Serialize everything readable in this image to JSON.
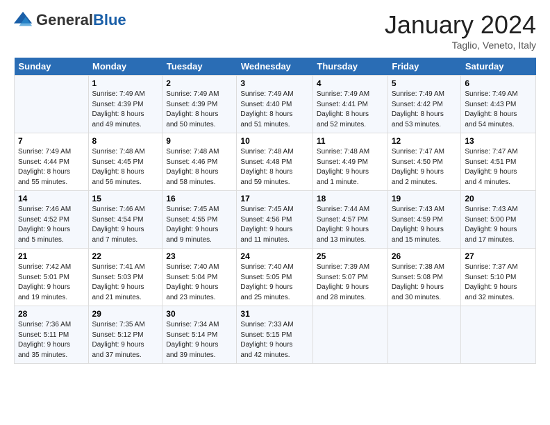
{
  "header": {
    "logo_general": "General",
    "logo_blue": "Blue",
    "month_title": "January 2024",
    "subtitle": "Taglio, Veneto, Italy"
  },
  "weekdays": [
    "Sunday",
    "Monday",
    "Tuesday",
    "Wednesday",
    "Thursday",
    "Friday",
    "Saturday"
  ],
  "weeks": [
    [
      {
        "day": "",
        "info": ""
      },
      {
        "day": "1",
        "info": "Sunrise: 7:49 AM\nSunset: 4:39 PM\nDaylight: 8 hours\nand 49 minutes."
      },
      {
        "day": "2",
        "info": "Sunrise: 7:49 AM\nSunset: 4:39 PM\nDaylight: 8 hours\nand 50 minutes."
      },
      {
        "day": "3",
        "info": "Sunrise: 7:49 AM\nSunset: 4:40 PM\nDaylight: 8 hours\nand 51 minutes."
      },
      {
        "day": "4",
        "info": "Sunrise: 7:49 AM\nSunset: 4:41 PM\nDaylight: 8 hours\nand 52 minutes."
      },
      {
        "day": "5",
        "info": "Sunrise: 7:49 AM\nSunset: 4:42 PM\nDaylight: 8 hours\nand 53 minutes."
      },
      {
        "day": "6",
        "info": "Sunrise: 7:49 AM\nSunset: 4:43 PM\nDaylight: 8 hours\nand 54 minutes."
      }
    ],
    [
      {
        "day": "7",
        "info": "Sunrise: 7:49 AM\nSunset: 4:44 PM\nDaylight: 8 hours\nand 55 minutes."
      },
      {
        "day": "8",
        "info": "Sunrise: 7:48 AM\nSunset: 4:45 PM\nDaylight: 8 hours\nand 56 minutes."
      },
      {
        "day": "9",
        "info": "Sunrise: 7:48 AM\nSunset: 4:46 PM\nDaylight: 8 hours\nand 58 minutes."
      },
      {
        "day": "10",
        "info": "Sunrise: 7:48 AM\nSunset: 4:48 PM\nDaylight: 8 hours\nand 59 minutes."
      },
      {
        "day": "11",
        "info": "Sunrise: 7:48 AM\nSunset: 4:49 PM\nDaylight: 9 hours\nand 1 minute."
      },
      {
        "day": "12",
        "info": "Sunrise: 7:47 AM\nSunset: 4:50 PM\nDaylight: 9 hours\nand 2 minutes."
      },
      {
        "day": "13",
        "info": "Sunrise: 7:47 AM\nSunset: 4:51 PM\nDaylight: 9 hours\nand 4 minutes."
      }
    ],
    [
      {
        "day": "14",
        "info": "Sunrise: 7:46 AM\nSunset: 4:52 PM\nDaylight: 9 hours\nand 5 minutes."
      },
      {
        "day": "15",
        "info": "Sunrise: 7:46 AM\nSunset: 4:54 PM\nDaylight: 9 hours\nand 7 minutes."
      },
      {
        "day": "16",
        "info": "Sunrise: 7:45 AM\nSunset: 4:55 PM\nDaylight: 9 hours\nand 9 minutes."
      },
      {
        "day": "17",
        "info": "Sunrise: 7:45 AM\nSunset: 4:56 PM\nDaylight: 9 hours\nand 11 minutes."
      },
      {
        "day": "18",
        "info": "Sunrise: 7:44 AM\nSunset: 4:57 PM\nDaylight: 9 hours\nand 13 minutes."
      },
      {
        "day": "19",
        "info": "Sunrise: 7:43 AM\nSunset: 4:59 PM\nDaylight: 9 hours\nand 15 minutes."
      },
      {
        "day": "20",
        "info": "Sunrise: 7:43 AM\nSunset: 5:00 PM\nDaylight: 9 hours\nand 17 minutes."
      }
    ],
    [
      {
        "day": "21",
        "info": "Sunrise: 7:42 AM\nSunset: 5:01 PM\nDaylight: 9 hours\nand 19 minutes."
      },
      {
        "day": "22",
        "info": "Sunrise: 7:41 AM\nSunset: 5:03 PM\nDaylight: 9 hours\nand 21 minutes."
      },
      {
        "day": "23",
        "info": "Sunrise: 7:40 AM\nSunset: 5:04 PM\nDaylight: 9 hours\nand 23 minutes."
      },
      {
        "day": "24",
        "info": "Sunrise: 7:40 AM\nSunset: 5:05 PM\nDaylight: 9 hours\nand 25 minutes."
      },
      {
        "day": "25",
        "info": "Sunrise: 7:39 AM\nSunset: 5:07 PM\nDaylight: 9 hours\nand 28 minutes."
      },
      {
        "day": "26",
        "info": "Sunrise: 7:38 AM\nSunset: 5:08 PM\nDaylight: 9 hours\nand 30 minutes."
      },
      {
        "day": "27",
        "info": "Sunrise: 7:37 AM\nSunset: 5:10 PM\nDaylight: 9 hours\nand 32 minutes."
      }
    ],
    [
      {
        "day": "28",
        "info": "Sunrise: 7:36 AM\nSunset: 5:11 PM\nDaylight: 9 hours\nand 35 minutes."
      },
      {
        "day": "29",
        "info": "Sunrise: 7:35 AM\nSunset: 5:12 PM\nDaylight: 9 hours\nand 37 minutes."
      },
      {
        "day": "30",
        "info": "Sunrise: 7:34 AM\nSunset: 5:14 PM\nDaylight: 9 hours\nand 39 minutes."
      },
      {
        "day": "31",
        "info": "Sunrise: 7:33 AM\nSunset: 5:15 PM\nDaylight: 9 hours\nand 42 minutes."
      },
      {
        "day": "",
        "info": ""
      },
      {
        "day": "",
        "info": ""
      },
      {
        "day": "",
        "info": ""
      }
    ]
  ]
}
